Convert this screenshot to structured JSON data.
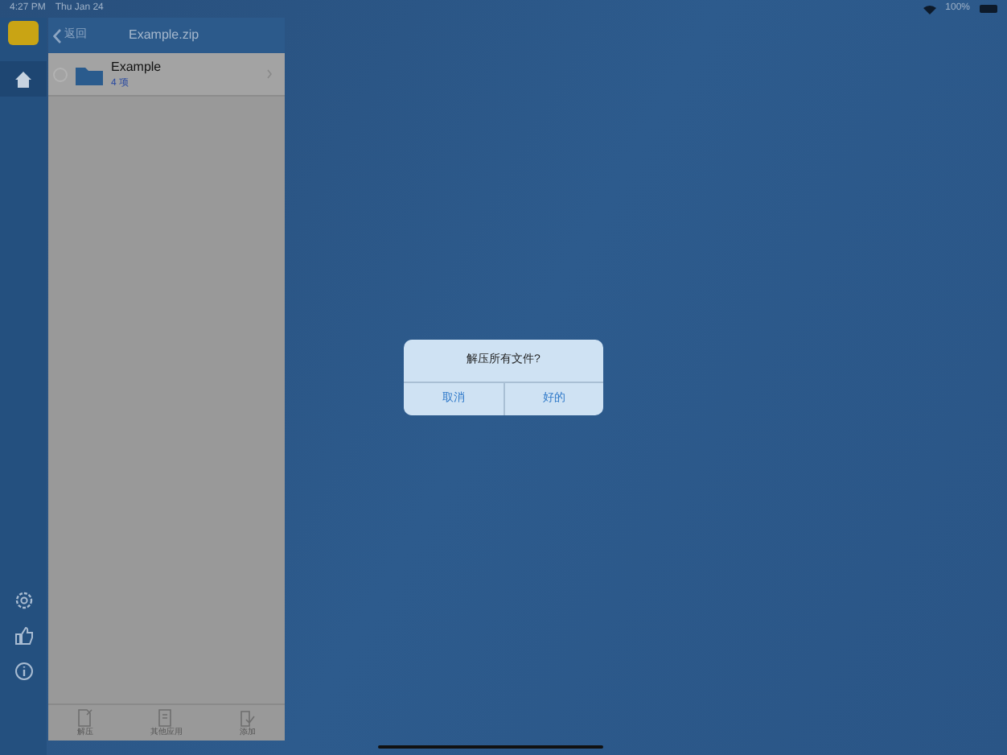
{
  "status_bar": {
    "time": "4:27 PM",
    "date": "Thu Jan 24",
    "battery": "100%"
  },
  "navigation": {
    "back": "返回",
    "title": "Example.zip"
  },
  "files": [
    {
      "name": "Example",
      "count": "4 项",
      "selected": false
    }
  ],
  "toolbar": [
    "解压",
    "其他应用",
    "添加"
  ],
  "dialog": {
    "message": "解压所有文件?",
    "buttons": [
      "取消",
      "好的"
    ]
  }
}
